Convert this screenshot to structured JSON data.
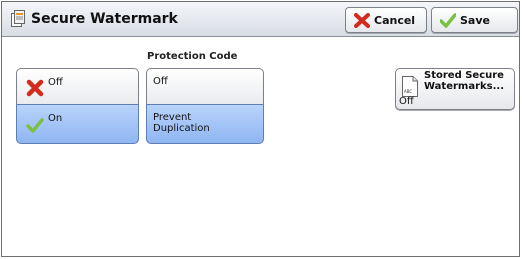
{
  "window": {
    "title": "Secure Watermark"
  },
  "toolbar": {
    "cancel_label": "Cancel",
    "save_label": "Save"
  },
  "watermark_toggle": {
    "options": [
      {
        "label": "Off",
        "selected": false
      },
      {
        "label": "On",
        "selected": true
      }
    ]
  },
  "protection_code": {
    "label": "Protection Code",
    "options": [
      {
        "label": "Off",
        "selected": false
      },
      {
        "label": "Prevent\nDuplication",
        "selected": true
      }
    ]
  },
  "stored_watermarks": {
    "label": "Stored Secure\nWatermarks...",
    "value": "Off",
    "icon_text": "ABC"
  },
  "colors": {
    "selected_bg": "#9fc2f6",
    "cancel_red": "#d42b1f",
    "check_green": "#7cc043"
  }
}
